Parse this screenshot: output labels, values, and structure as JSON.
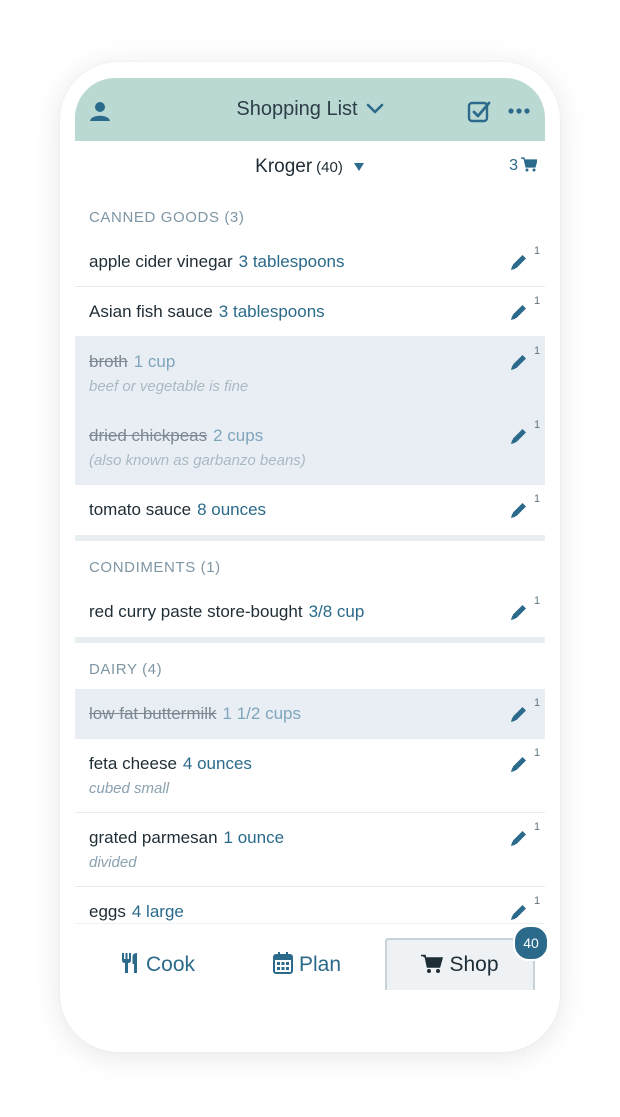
{
  "header": {
    "title": "Shopping List",
    "icons": [
      "user-icon",
      "chevron-down-icon",
      "checkbox-icon",
      "more-icon"
    ]
  },
  "store": {
    "name": "Kroger",
    "count": "(40)",
    "cart_count": "3"
  },
  "sections": [
    {
      "title": "CANNED GOODS (3)",
      "items": [
        {
          "name": "apple cider vinegar",
          "qty": "3 tablespoons",
          "note": "",
          "done": false,
          "badge": "1"
        },
        {
          "name": "Asian fish sauce",
          "qty": "3 tablespoons",
          "note": "",
          "done": false,
          "badge": "1"
        },
        {
          "name": "broth",
          "qty": "1 cup",
          "note": "beef or vegetable is fine",
          "done": true,
          "badge": "1"
        },
        {
          "name": "dried chickpeas",
          "qty": "2 cups",
          "note": "(also known as garbanzo beans)",
          "done": true,
          "badge": "1"
        },
        {
          "name": "tomato sauce",
          "qty": "8 ounces",
          "note": "",
          "done": false,
          "badge": "1"
        }
      ]
    },
    {
      "title": "CONDIMENTS (1)",
      "items": [
        {
          "name": "red curry paste store-bought",
          "qty": "3/8 cup",
          "note": "",
          "done": false,
          "badge": "1"
        }
      ]
    },
    {
      "title": "DAIRY (4)",
      "items": [
        {
          "name": "low fat buttermilk",
          "qty": "1 1/2 cups",
          "note": "",
          "done": true,
          "badge": "1"
        },
        {
          "name": "feta cheese",
          "qty": "4 ounces",
          "note": "cubed small",
          "done": false,
          "badge": "1"
        },
        {
          "name": "grated parmesan",
          "qty": "1 ounce",
          "note": "divided",
          "done": false,
          "badge": "1"
        },
        {
          "name": "eggs",
          "qty": "4 large",
          "note": "",
          "done": false,
          "badge": "1"
        }
      ]
    }
  ],
  "tabs": {
    "cook": "Cook",
    "plan": "Plan",
    "shop": "Shop",
    "shop_badge": "40"
  },
  "colors": {
    "header_bg": "#bbd9d3",
    "accent": "#2b6a8a",
    "done_row_bg": "#e9eef4"
  }
}
